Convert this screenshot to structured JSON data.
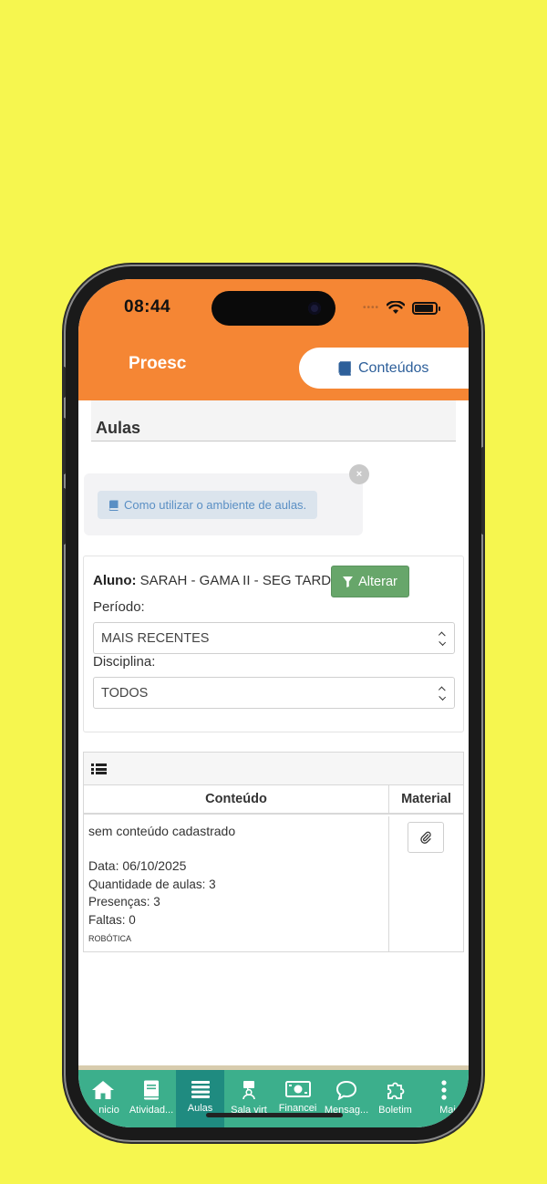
{
  "status_bar": {
    "time": "08:44",
    "dots": "••••"
  },
  "header": {
    "brand": "Proesc",
    "tab_label": "Conteúdos"
  },
  "page": {
    "title": "Aulas"
  },
  "help": {
    "label": "Como utilizar o ambiente de aulas.",
    "close": "×"
  },
  "filters": {
    "aluno_label": "Aluno:",
    "aluno_value": "SARAH - GAMA II - SEG TARDE",
    "alterar_label": "Alterar",
    "periodo_label": "Período:",
    "periodo_value": "MAIS RECENTES",
    "disciplina_label": "Disciplina:",
    "disciplina_value": "TODOS"
  },
  "table": {
    "col_conteudo": "Conteúdo",
    "col_material": "Material",
    "row": {
      "conteudo": "sem conteúdo cadastrado",
      "data": "Data: 06/10/2025",
      "quantidade": "Quantidade de aulas: 3",
      "presencas": "Presenças: 3",
      "faltas": "Faltas: 0",
      "disciplina": "ROBÓTICA"
    }
  },
  "tabbar": {
    "items": [
      {
        "label": "nicio",
        "icon": "home-icon"
      },
      {
        "label": "Atividad...",
        "icon": "book-icon"
      },
      {
        "label": "Aulas",
        "icon": "list-icon"
      },
      {
        "label": "Sala virt",
        "icon": "virtual-room-icon"
      },
      {
        "label": "Financei",
        "icon": "money-icon"
      },
      {
        "label": "Mensag...",
        "icon": "chat-icon"
      },
      {
        "label": "Boletim",
        "icon": "puzzle-icon"
      },
      {
        "label": "Mai",
        "icon": "more-icon"
      }
    ]
  },
  "colors": {
    "header": "#f58634",
    "tabbar": "#3caf8c",
    "tabbar_active": "#1f8b80",
    "background": "#f6f64f",
    "alterar": "#67a66a"
  }
}
